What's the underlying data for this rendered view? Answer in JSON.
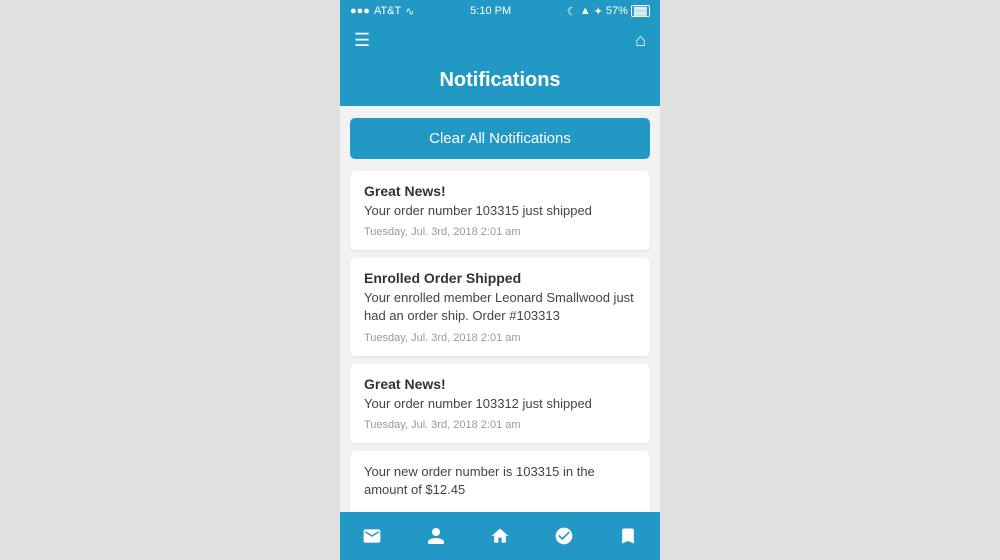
{
  "statusBar": {
    "carrier": "AT&T",
    "time": "5:10 PM",
    "battery": "57%",
    "signal": "●●●"
  },
  "header": {
    "title": "Notifications"
  },
  "clearButton": {
    "label": "Clear All Notifications"
  },
  "notifications": [
    {
      "title": "Great News!",
      "body": "Your order number 103315 just shipped",
      "time": "Tuesday, Jul. 3rd, 2018 2:01 am"
    },
    {
      "title": "Enrolled Order Shipped",
      "body": "Your enrolled member Leonard Smallwood just had an order ship. Order #103313",
      "time": "Tuesday, Jul. 3rd, 2018 2:01 am"
    },
    {
      "title": "Great News!",
      "body": "Your order number 103312 just shipped",
      "time": "Tuesday, Jul. 3rd, 2018 2:01 am"
    },
    {
      "title": "",
      "body": "Your new order number is 103315 in the amount of $12.45",
      "time": ""
    }
  ],
  "tabBar": {
    "tabs": [
      "mail",
      "person",
      "home",
      "check-circle",
      "bookmark"
    ]
  }
}
